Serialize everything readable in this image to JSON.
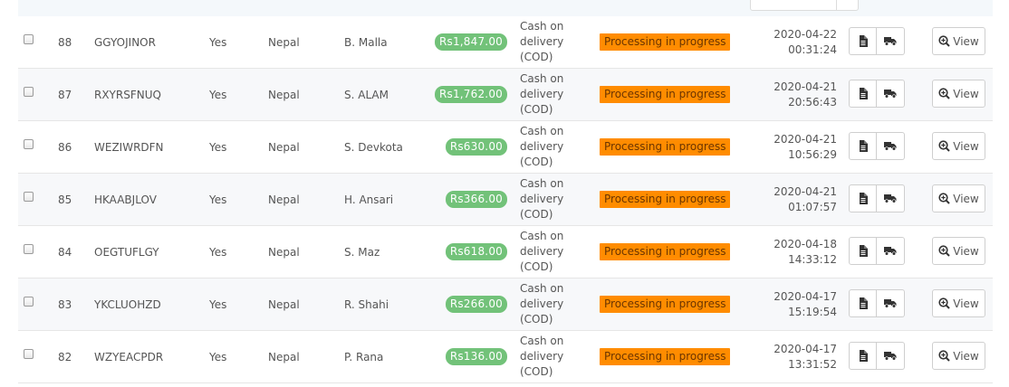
{
  "orders": [
    {
      "id": "88",
      "reference": "GGYOJINOR",
      "new_client": "Yes",
      "country": "Nepal",
      "customer": "B. Malla",
      "total": "Rs1,847.00",
      "payment": "Cash on delivery (COD)",
      "status": "Processing in progress",
      "date": "2020-04-22",
      "time": "00:31:24"
    },
    {
      "id": "87",
      "reference": "RXYRSFNUQ",
      "new_client": "Yes",
      "country": "Nepal",
      "customer": "S. ALAM",
      "total": "Rs1,762.00",
      "payment": "Cash on delivery (COD)",
      "status": "Processing in progress",
      "date": "2020-04-21",
      "time": "20:56:43"
    },
    {
      "id": "86",
      "reference": "WEZIWRDFN",
      "new_client": "Yes",
      "country": "Nepal",
      "customer": "S. Devkota",
      "total": "Rs630.00",
      "payment": "Cash on delivery (COD)",
      "status": "Processing in progress",
      "date": "2020-04-21",
      "time": "10:56:29"
    },
    {
      "id": "85",
      "reference": "HKAABJLOV",
      "new_client": "Yes",
      "country": "Nepal",
      "customer": "H. Ansari",
      "total": "Rs366.00",
      "payment": "Cash on delivery (COD)",
      "status": "Processing in progress",
      "date": "2020-04-21",
      "time": "01:07:57"
    },
    {
      "id": "84",
      "reference": "OEGTUFLGY",
      "new_client": "Yes",
      "country": "Nepal",
      "customer": "S. Maz",
      "total": "Rs618.00",
      "payment": "Cash on delivery (COD)",
      "status": "Processing in progress",
      "date": "2020-04-18",
      "time": "14:33:12"
    },
    {
      "id": "83",
      "reference": "YKCLUOHZD",
      "new_client": "Yes",
      "country": "Nepal",
      "customer": "R. Shahi",
      "total": "Rs266.00",
      "payment": "Cash on delivery (COD)",
      "status": "Processing in progress",
      "date": "2020-04-17",
      "time": "15:19:54"
    },
    {
      "id": "82",
      "reference": "WZYEACPDR",
      "new_client": "Yes",
      "country": "Nepal",
      "customer": "P. Rana",
      "total": "Rs136.00",
      "payment": "Cash on delivery (COD)",
      "status": "Processing in progress",
      "date": "2020-04-17",
      "time": "13:31:52"
    }
  ],
  "actions": {
    "view_label": "View",
    "invoice_icon": "file-icon",
    "delivery_icon": "truck-icon",
    "view_icon": "zoom-in-icon"
  },
  "colors": {
    "price_badge": "#72c279",
    "status_badge": "#ff8c00",
    "status_text": "#6b3500"
  }
}
